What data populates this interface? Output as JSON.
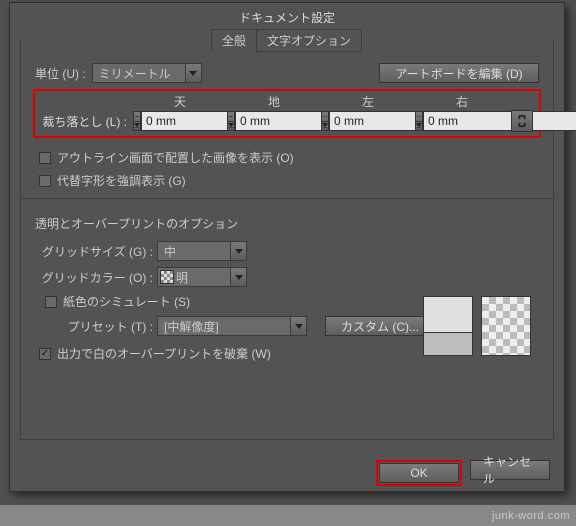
{
  "title": "ドキュメント設定",
  "tabs": {
    "general": "全般",
    "text": "文字オプション"
  },
  "units": {
    "label": "単位 (U) :",
    "value": "ミリメートル"
  },
  "editArtboards": "アートボードを編集 (D)",
  "bleed": {
    "label": "裁ち落とし (L) :",
    "headers": {
      "top": "天",
      "bottom": "地",
      "left": "左",
      "right": "右"
    },
    "values": {
      "top": "0 mm",
      "bottom": "0 mm",
      "left": "0 mm",
      "right": "0 mm"
    }
  },
  "checks": {
    "outline": "アウトライン画面で配置した画像を表示 (O)",
    "altglyph": "代替字形を強調表示 (G)",
    "papercolor": "紙色のシミュレート (S)",
    "discard": "出力で白のオーバープリントを破棄 (W)"
  },
  "section": "透明とオーバープリントのオプション",
  "gridsize": {
    "label": "グリッドサイズ (G) :",
    "value": "中"
  },
  "gridcolor": {
    "label": "グリッドカラー (O) :",
    "value": "明"
  },
  "preset": {
    "label": "プリセット (T) :",
    "value": "[中解像度]"
  },
  "custom": "カスタム (C)...",
  "footer": {
    "ok": "OK",
    "cancel": "キャンセル"
  },
  "watermark": "junk-word.com"
}
